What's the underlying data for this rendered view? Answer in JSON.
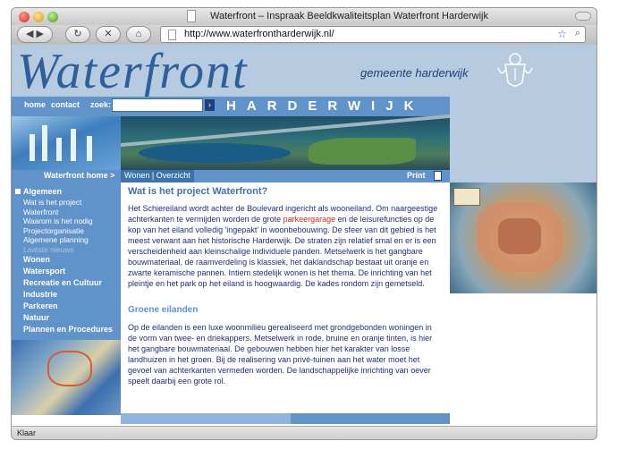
{
  "window": {
    "title": "Waterfront – Inspraak Beeldkwaliteitsplan Waterfront Harderwijk",
    "url": "http://www.waterfrontharderwijk.nl/",
    "status": "Klaar"
  },
  "header": {
    "logo": "Waterfront",
    "gemeente": "gemeente harderwijk"
  },
  "nav": {
    "home": "home",
    "contact": "contact",
    "zoek_label": "zoek:",
    "zoek_value": "",
    "go": "›",
    "city": "HARDERWIJK"
  },
  "crumbs": {
    "home": "Waterfront home >",
    "path": "Wonen | Overzicht",
    "print": "Print"
  },
  "sidebar": {
    "section": "Algemeen",
    "subitems": [
      "Wat is het project",
      "Waterfront",
      "Waarom is het nodig",
      "Projectorganisatie",
      "Algemene planning"
    ],
    "muted_item": "Laatste nieuws",
    "items": [
      "Wonen",
      "Watersport",
      "Recreatie en Cultuur",
      "Industrie",
      "Parkeren",
      "Natuur",
      "Plannen en Procedures"
    ]
  },
  "content": {
    "h1": "Wat is het project Waterfront?",
    "p1_a": "Het Schiereiland wordt achter de Boulevard ingericht als wooneiland. Om naargeestige achterkanten te vermijden worden de grote ",
    "p1_hl": "parkeergarage",
    "p1_b": " en de leisurefuncties op de kop van het eiland volledig 'ingepakt' in woonbebouwing. De sfeer van dit gebied is het meest verwant aan het historische Harderwijk. De straten zijn relatief smal en er is een verscheidenheid aan kleinschalige individuele panden. Metselwerk is het gangbare bouwmateriaal, de raamverdeling is klassiek, het daklandschap bestaat uit oranje en zwarte keramische pannen. Intiem stedelijk wonen is het thema. De inrichting van het pleintje en het park op het eiland is hoogwaardig. De kades rondom zijn gemetseld.",
    "h2": "Groene eilanden",
    "p2": "Op de eilanden is een luxe woonmilieu gerealiseerd met grondgebonden woningen in de vorm van twee- en driekappers. Metselwerk in rode, bruine en oranje tinten, is hier het gangbare bouwmateriaal. De gebouwen hebben hier het karakter van losse landhuizen in het groen. Bij de realisering van privé-tuinen aan het water moet het gevoel van achterkanten vermeden worden. De landschappelijke inrichting van oever speelt daarbij een grote rol."
  },
  "colors": {
    "nav_blue": "#5f93c9",
    "header_blue": "#b7cbe0",
    "heading_blue": "#3d73ad",
    "text_navy": "#1f2f78",
    "highlight_red": "#d8261e"
  }
}
